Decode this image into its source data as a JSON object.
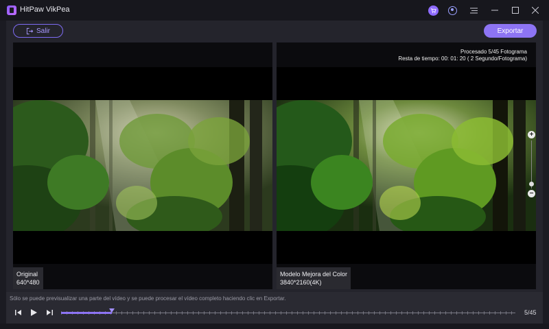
{
  "app": {
    "title": "HitPaw VikPea"
  },
  "toolbar": {
    "exit_label": "Salir",
    "export_label": "Exportar"
  },
  "progress": {
    "processed": "Procesado 5/45 Fotograma",
    "remaining": "Resta de tiempo: 00: 01: 20 ( 2 Segundo/Fotograma)"
  },
  "original": {
    "name": "Original",
    "resolution": "640*480"
  },
  "enhanced": {
    "name": "Modelo Mejora del Color",
    "resolution": "3840*2160(4K)"
  },
  "zoom": {
    "plus": "+",
    "minus": "−",
    "level_fraction": 0.85
  },
  "bottom": {
    "hint": "Sólo se puede previsualizar una parte del vídeo y se puede procesar el vídeo completo haciendo clic en Exportar.",
    "frame_counter": "5/45",
    "current_frame": 5,
    "total_frames": 45
  },
  "colors": {
    "accent": "#8d74f4",
    "accent_light": "#a898ff",
    "background": "#1b1b22"
  }
}
